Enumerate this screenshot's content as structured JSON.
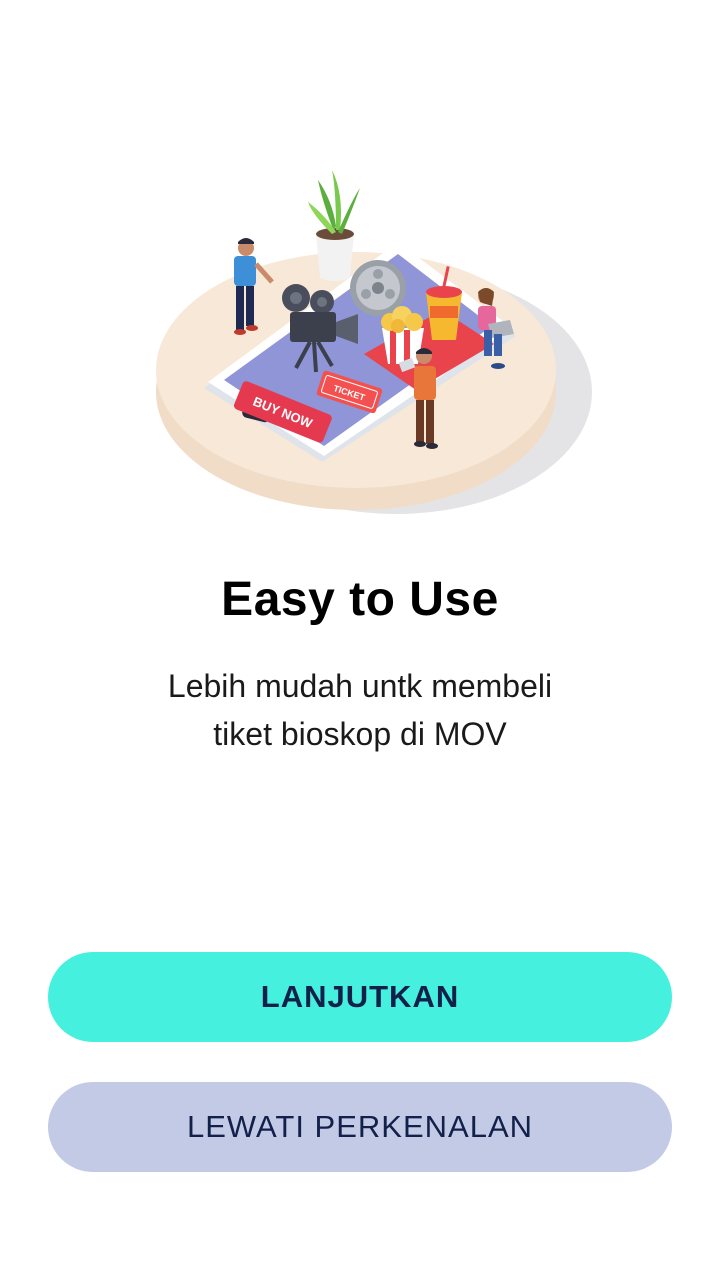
{
  "onboarding": {
    "illustration": {
      "buy_now_label": "BUY NOW",
      "ticket_label": "TICKET"
    },
    "title": "Easy to Use",
    "subtitle_line1": "Lebih mudah untk membeli",
    "subtitle_line2": "tiket bioskop di MOV",
    "continue_label": "LANJUTKAN",
    "skip_label": "LEWATI PERKENALAN"
  },
  "colors": {
    "primary_button": "#45f0df",
    "secondary_button": "#c2cae6",
    "button_text": "#12204a"
  }
}
